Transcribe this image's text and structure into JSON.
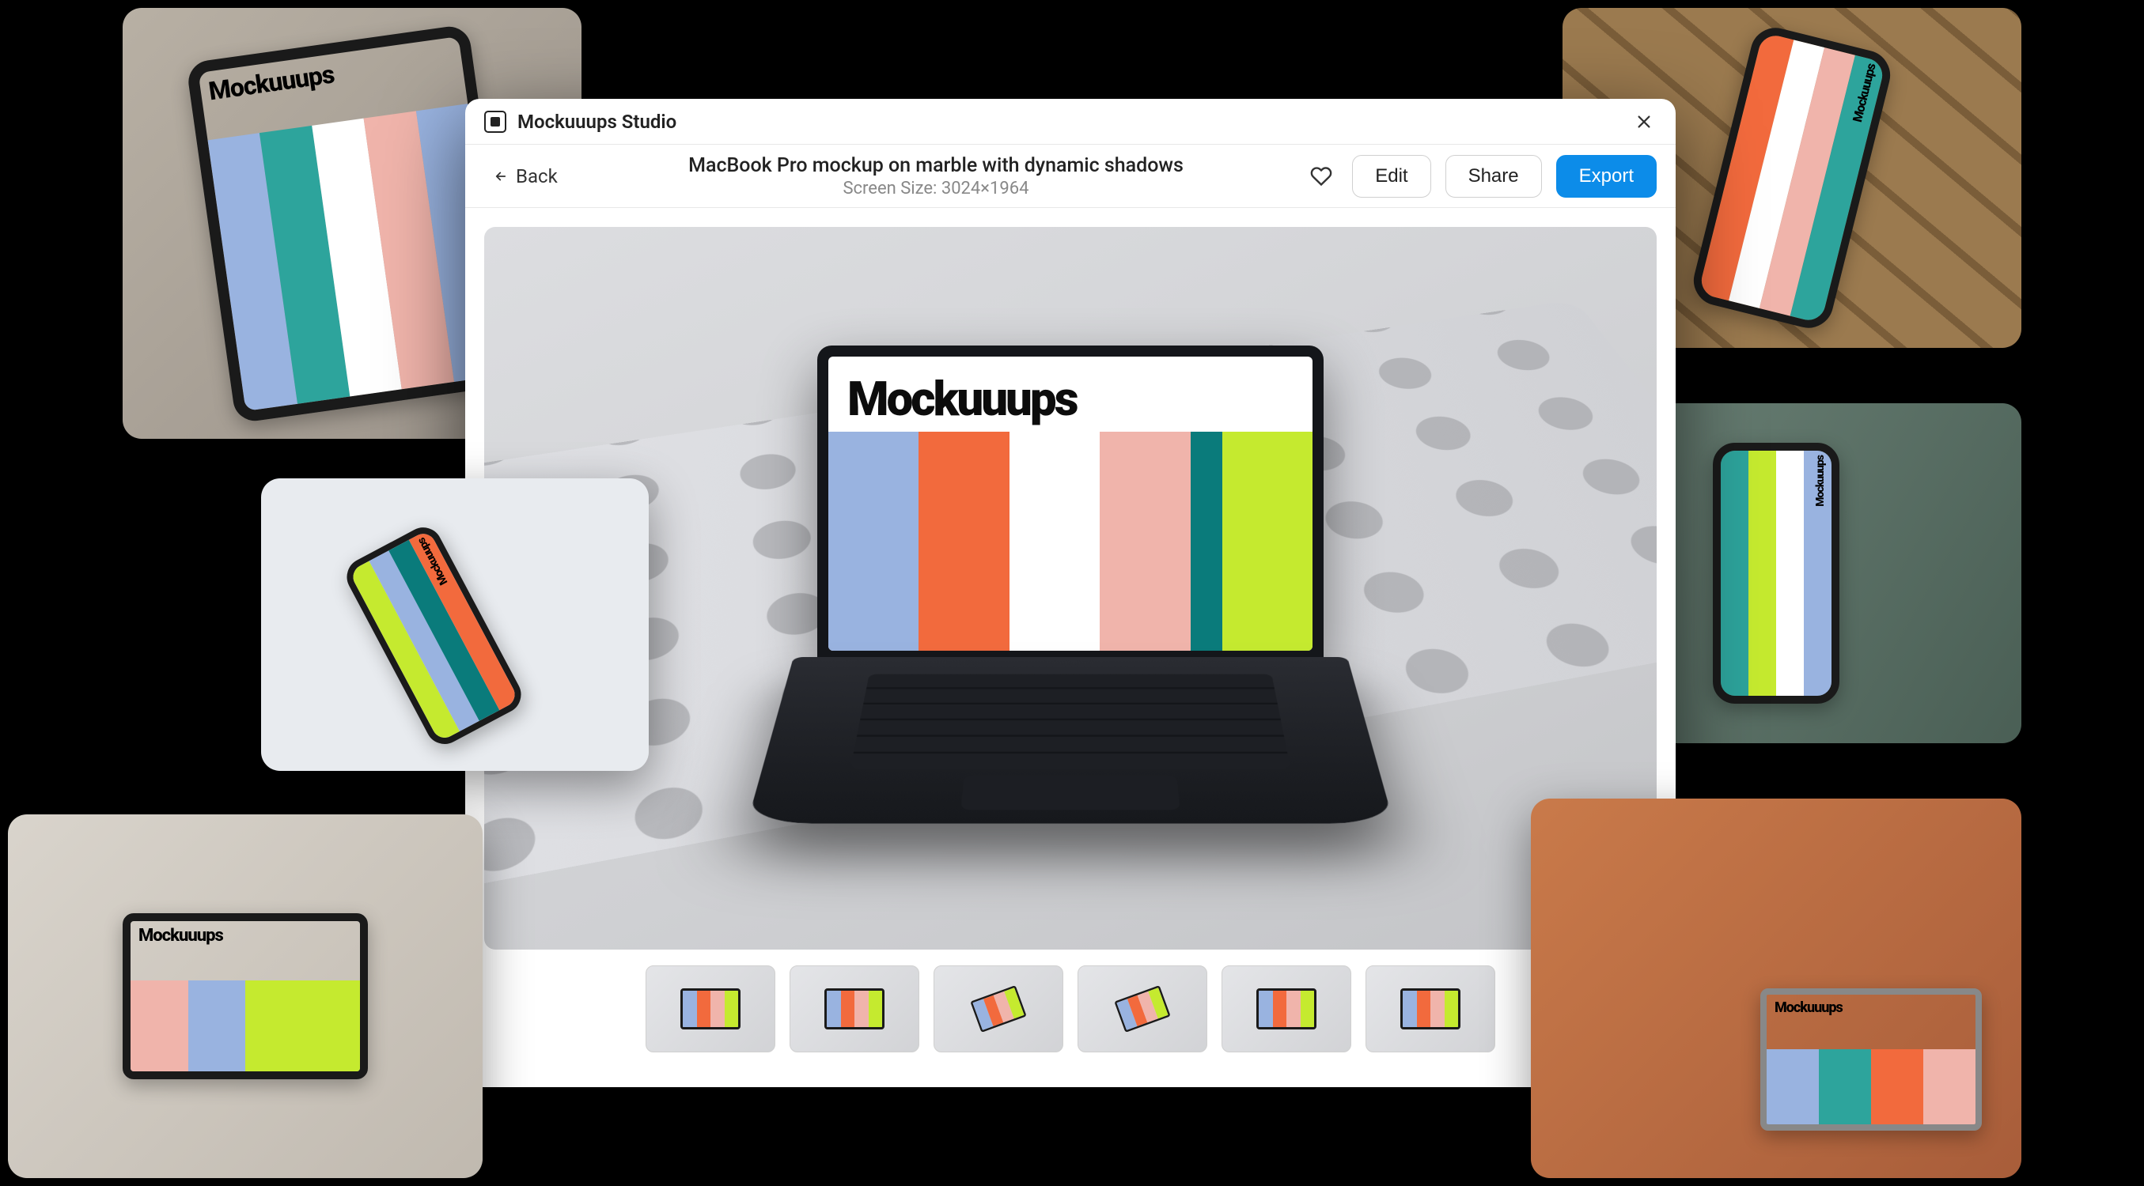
{
  "app": {
    "name": "Mockuuups Studio",
    "logo_text": "Mockuuups"
  },
  "toolbar": {
    "back_label": "Back",
    "edit_label": "Edit",
    "share_label": "Share",
    "export_label": "Export"
  },
  "mockup": {
    "title": "MacBook Pro mockup on marble with dynamic shadows",
    "meta": "Screen Size: 3024×1964"
  },
  "thumbnails": {
    "count": 6
  },
  "palette": {
    "blue": "#99b3e0",
    "teal": "#2da49c",
    "orange": "#f26a3d",
    "white": "#ffffff",
    "pink": "#f0b4ab",
    "lime": "#c5ea2f",
    "teal_dark": "#0a7b7b",
    "primary": "#0c8ce9"
  }
}
